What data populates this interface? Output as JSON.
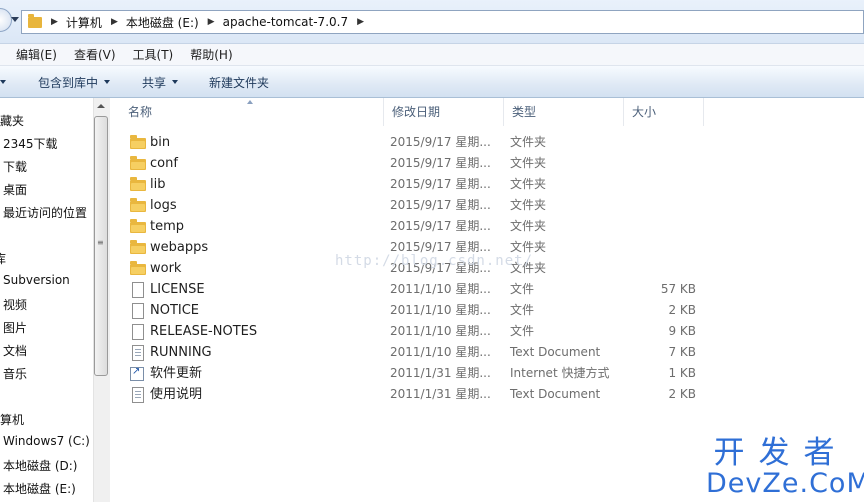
{
  "address": {
    "crumbs": [
      "计算机",
      "本地磁盘 (E:)",
      "apache-tomcat-7.0.7"
    ]
  },
  "menu": [
    "编辑(E)",
    "查看(V)",
    "工具(T)",
    "帮助(H)"
  ],
  "toolbar": {
    "include_library": "包含到库中",
    "share": "共享",
    "new_folder": "新建文件夹"
  },
  "nav": {
    "favorites": "收藏夹",
    "downloads_2345": "2345下载",
    "downloads": "下载",
    "desktop": "桌面",
    "recent": "最近访问的位置",
    "libraries": "库",
    "subversion": "Subversion",
    "videos": "视频",
    "pictures": "图片",
    "documents": "文档",
    "music": "音乐",
    "computer": "计算机",
    "drive_c": "Windows7 (C:)",
    "drive_d": "本地磁盘 (D:)",
    "drive_e": "本地磁盘 (E:)"
  },
  "columns": {
    "name": "名称",
    "date": "修改日期",
    "type": "类型",
    "size": "大小"
  },
  "files": [
    {
      "name": "bin",
      "date": "2015/9/17 星期...",
      "type": "文件夹",
      "size": "",
      "icon": "folder-icon"
    },
    {
      "name": "conf",
      "date": "2015/9/17 星期...",
      "type": "文件夹",
      "size": "",
      "icon": "folder-icon"
    },
    {
      "name": "lib",
      "date": "2015/9/17 星期...",
      "type": "文件夹",
      "size": "",
      "icon": "folder-icon"
    },
    {
      "name": "logs",
      "date": "2015/9/17 星期...",
      "type": "文件夹",
      "size": "",
      "icon": "folder-icon"
    },
    {
      "name": "temp",
      "date": "2015/9/17 星期...",
      "type": "文件夹",
      "size": "",
      "icon": "folder-icon"
    },
    {
      "name": "webapps",
      "date": "2015/9/17 星期...",
      "type": "文件夹",
      "size": "",
      "icon": "folder-icon"
    },
    {
      "name": "work",
      "date": "2015/9/17 星期...",
      "type": "文件夹",
      "size": "",
      "icon": "folder-icon"
    },
    {
      "name": "LICENSE",
      "date": "2011/1/10 星期...",
      "type": "文件",
      "size": "57 KB",
      "icon": "file-icon"
    },
    {
      "name": "NOTICE",
      "date": "2011/1/10 星期...",
      "type": "文件",
      "size": "2 KB",
      "icon": "file-icon"
    },
    {
      "name": "RELEASE-NOTES",
      "date": "2011/1/10 星期...",
      "type": "文件",
      "size": "9 KB",
      "icon": "file-icon"
    },
    {
      "name": "RUNNING",
      "date": "2011/1/10 星期...",
      "type": "Text Document",
      "size": "7 KB",
      "icon": "text-document-icon"
    },
    {
      "name": "软件更新",
      "date": "2011/1/31 星期...",
      "type": "Internet 快捷方式",
      "size": "1 KB",
      "icon": "internet-shortcut-icon"
    },
    {
      "name": "使用说明",
      "date": "2011/1/31 星期...",
      "type": "Text Document",
      "size": "2 KB",
      "icon": "text-document-icon"
    }
  ],
  "watermark": "http://blog.csdn.net/",
  "brand": {
    "cn": "开发者",
    "en": "DevZe.CoM"
  },
  "colors": {
    "brand": "#2f6fd6",
    "folder": "#e9b73f"
  }
}
